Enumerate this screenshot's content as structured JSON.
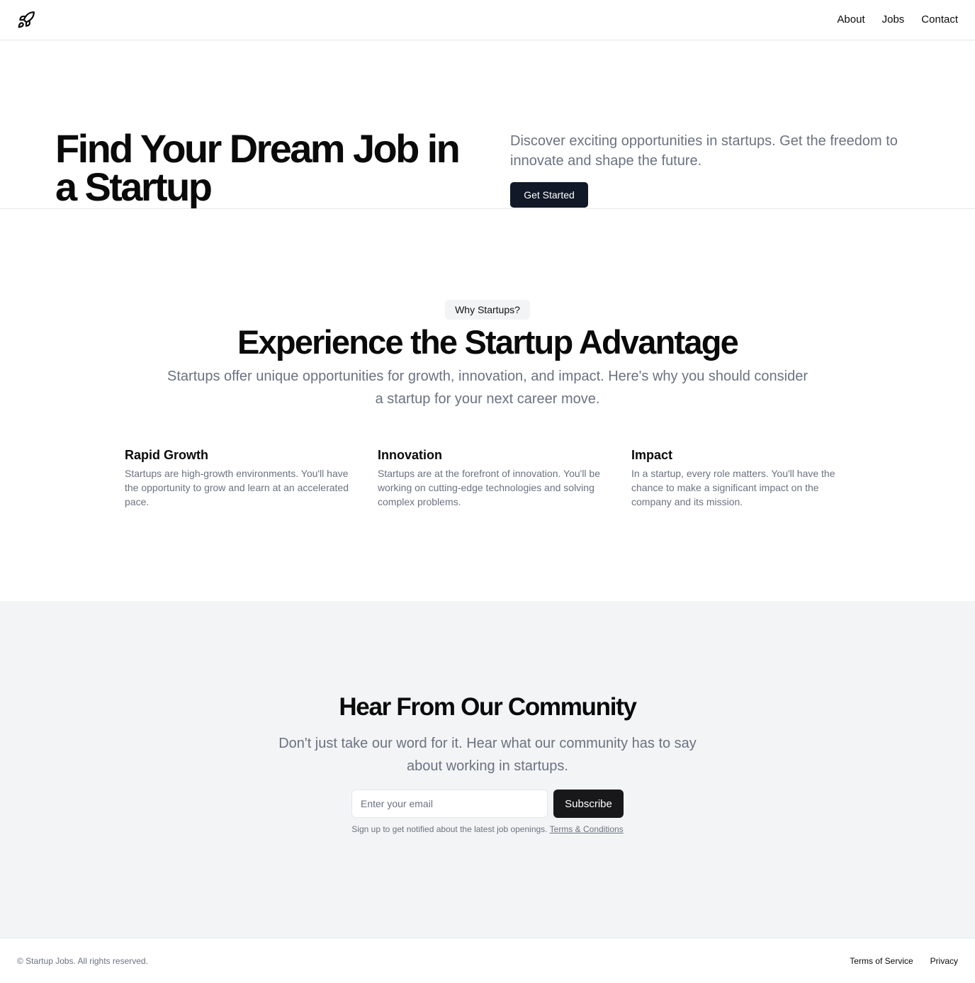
{
  "header": {
    "logo_icon": "rocket-icon",
    "nav": [
      {
        "label": "About"
      },
      {
        "label": "Jobs"
      },
      {
        "label": "Contact"
      }
    ]
  },
  "hero": {
    "title": "Find Your Dream Job in a Startup",
    "description": "Discover exciting opportunities in startups. Get the freedom to innovate and shape the future.",
    "cta_label": "Get Started"
  },
  "why": {
    "badge": "Why Startups?",
    "title": "Experience the Startup Advantage",
    "description": "Startups offer unique opportunities for growth, innovation, and impact. Here's why you should consider a startup for your next career move.",
    "features": [
      {
        "title": "Rapid Growth",
        "text": "Startups are high-growth environments. You'll have the opportunity to grow and learn at an accelerated pace."
      },
      {
        "title": "Innovation",
        "text": "Startups are at the forefront of innovation. You'll be working on cutting-edge technologies and solving complex problems."
      },
      {
        "title": "Impact",
        "text": "In a startup, every role matters. You'll have the chance to make a significant impact on the company and its mission."
      }
    ]
  },
  "community": {
    "title": "Hear From Our Community",
    "description": "Don't just take our word for it. Hear what our community has to say about working in startups.",
    "email_placeholder": "Enter your email",
    "subscribe_label": "Subscribe",
    "note": "Sign up to get notified about the latest job openings.",
    "terms_label": "Terms & Conditions"
  },
  "footer": {
    "copyright": "© Startup Jobs. All rights reserved.",
    "links": [
      {
        "label": "Terms of Service"
      },
      {
        "label": "Privacy"
      }
    ]
  },
  "colors": {
    "primary_button": "#111827",
    "subscribe_button": "#18181b",
    "muted_text": "#6b7280",
    "section_background": "#f3f4f6",
    "border": "#e5e7eb"
  }
}
